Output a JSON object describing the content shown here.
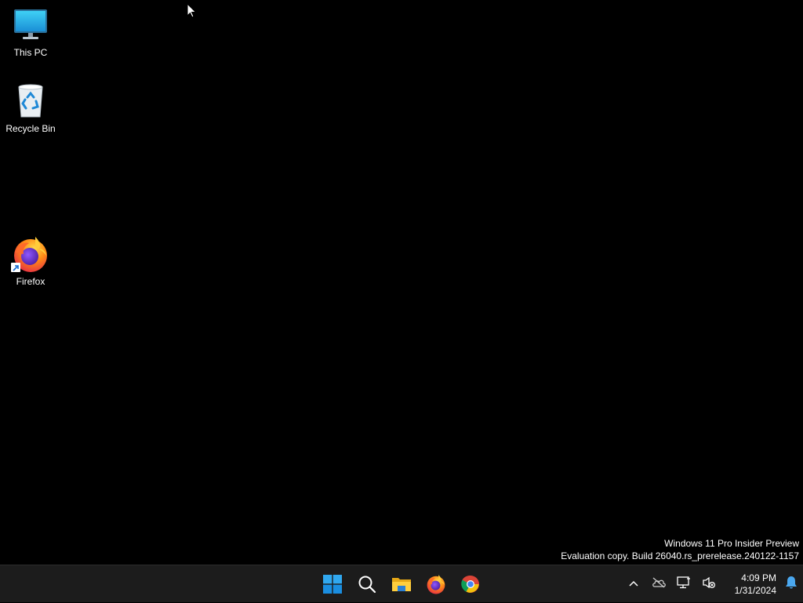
{
  "desktop": {
    "icons": [
      {
        "label": "This PC",
        "icon": "monitor-icon"
      },
      {
        "label": "Recycle Bin",
        "icon": "recycle-bin-icon"
      },
      {
        "label": "Firefox",
        "icon": "firefox-icon"
      }
    ]
  },
  "watermark": {
    "line1": "Windows 11 Pro Insider Preview",
    "line2": "Evaluation copy. Build 26040.rs_prerelease.240122-1157"
  },
  "taskbar": {
    "pinned": [
      {
        "name": "start",
        "icon": "windows-logo-icon"
      },
      {
        "name": "search",
        "icon": "search-icon"
      },
      {
        "name": "file-explorer",
        "icon": "folder-icon"
      },
      {
        "name": "firefox",
        "icon": "firefox-icon"
      },
      {
        "name": "chrome",
        "icon": "chrome-icon"
      }
    ],
    "tray": {
      "icons": [
        "chevron-up-icon",
        "onedrive-offline-icon",
        "network-icon",
        "volume-muted-icon",
        "notification-bell-icon"
      ],
      "time": "4:09 PM",
      "date": "1/31/2024"
    }
  },
  "colors": {
    "desktop_background": "#000000",
    "taskbar_background": "#1c1c1c",
    "accent": "#0078d4"
  }
}
